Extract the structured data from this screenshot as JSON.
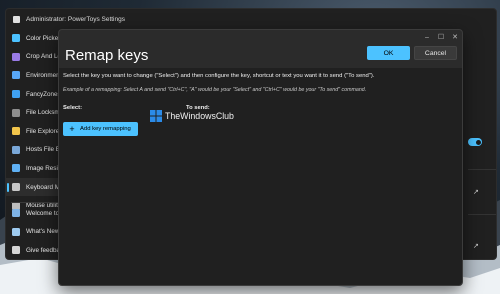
{
  "window": {
    "title": "Administrator: PowerToys Settings"
  },
  "sidebar": {
    "items": [
      {
        "label": "Color Picker",
        "icon": "color-picker-icon",
        "color": "#4cc2ff"
      },
      {
        "label": "Crop And Lo",
        "icon": "crop-lock-icon",
        "color": "#9a7be6"
      },
      {
        "label": "Environmen",
        "icon": "environment-icon",
        "color": "#58a6f5"
      },
      {
        "label": "FancyZones",
        "icon": "fancyzones-icon",
        "color": "#3fa0f0"
      },
      {
        "label": "File Locksmi",
        "icon": "file-locksmith-icon",
        "color": "#8e8e8e"
      },
      {
        "label": "File Explore",
        "icon": "file-explorer-icon",
        "color": "#f2c54b"
      },
      {
        "label": "Hosts File E",
        "icon": "hosts-file-icon",
        "color": "#7aa8d8"
      },
      {
        "label": "Image Resiz",
        "icon": "image-resizer-icon",
        "color": "#5fb0f3"
      },
      {
        "label": "Keyboard M",
        "icon": "keyboard-icon",
        "color": "#c8c8c8",
        "active": true
      },
      {
        "label": "Mouse utiliti",
        "icon": "mouse-icon",
        "color": "#bdbdbd"
      }
    ],
    "bottom_items": [
      {
        "label": "Welcome to",
        "icon": "welcome-icon",
        "color": "#7fb4e8"
      },
      {
        "label": "What's New",
        "icon": "whats-new-icon",
        "color": "#9ecbf0"
      },
      {
        "label": "Give feedba",
        "icon": "feedback-icon",
        "color": "#d6d6d6"
      }
    ]
  },
  "dialog": {
    "title": "Remap keys",
    "ok_label": "OK",
    "cancel_label": "Cancel",
    "instructions": "Select the key you want to change (\"Select\") and then configure the key, shortcut or text you want it to send (\"To send\").",
    "example": "Example of a remapping: Select A and send \"Ctrl+C\", \"A\" would be your \"Select\" and \"Ctrl+C\" would be your \"To send\" command.",
    "select_label": "Select:",
    "to_send_label": "To send:",
    "add_button_label": "Add key remapping"
  },
  "watermark": {
    "text": "TheWindowsClub"
  },
  "colors": {
    "accent": "#4cc2ff"
  }
}
